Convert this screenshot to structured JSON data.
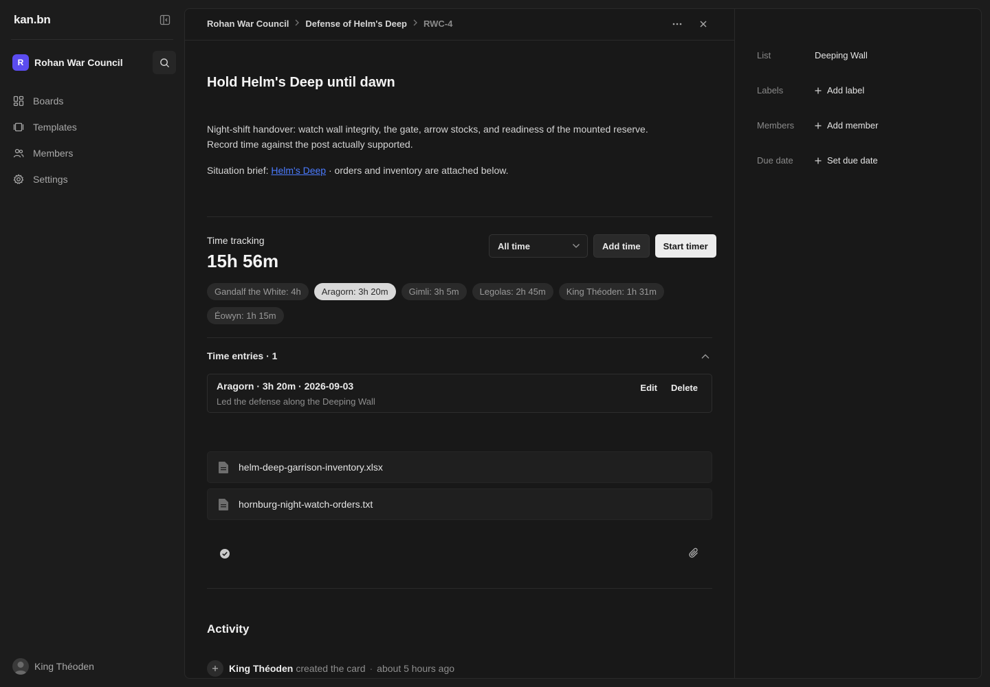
{
  "app": {
    "logo": "kan.bn"
  },
  "sidebar": {
    "workspace": {
      "initial": "R",
      "name": "Rohan War Council",
      "color": "#5b4cf0"
    },
    "items": [
      {
        "label": "Boards",
        "icon": "boards-icon"
      },
      {
        "label": "Templates",
        "icon": "templates-icon"
      },
      {
        "label": "Members",
        "icon": "members-icon"
      },
      {
        "label": "Settings",
        "icon": "settings-icon"
      }
    ],
    "user": {
      "name": "King Théoden"
    }
  },
  "breadcrumb": [
    "Rohan War Council",
    "Defense of Helm's Deep",
    "RWC-4"
  ],
  "card": {
    "title": "Hold Helm's Deep until dawn",
    "description": {
      "p1": "Night-shift handover: watch wall integrity, the gate, arrow stocks, and readiness of the mounted reserve. Record time against the post actually supported.",
      "p2_prefix": "Situation brief: ",
      "p2_link": "Helm's Deep",
      "p2_suffix": " · orders and inventory are attached below."
    }
  },
  "time_tracking": {
    "label": "Time tracking",
    "total": "15h 56m",
    "range_select": "All time",
    "add_time_label": "Add time",
    "start_timer_label": "Start timer",
    "chips": [
      {
        "label": "Gandalf the White: 4h",
        "active": false
      },
      {
        "label": "Aragorn: 3h 20m",
        "active": true
      },
      {
        "label": "Gimli: 3h 5m",
        "active": false
      },
      {
        "label": "Legolas: 2h 45m",
        "active": false
      },
      {
        "label": "King Théoden: 1h 31m",
        "active": false
      },
      {
        "label": "Éowyn: 1h 15m",
        "active": false
      }
    ]
  },
  "time_entries": {
    "heading": "Time entries · 1",
    "items": [
      {
        "title": "Aragorn · 3h 20m · 2026-09-03",
        "note": "Led the defense along the Deeping Wall",
        "edit_label": "Edit",
        "delete_label": "Delete"
      }
    ]
  },
  "attachments": [
    {
      "name": "helm-deep-garrison-inventory.xlsx"
    },
    {
      "name": "hornburg-night-watch-orders.txt"
    }
  ],
  "activity": {
    "title": "Activity",
    "items": [
      {
        "user": "King Théoden",
        "text": "created the card",
        "time": "about 5 hours ago"
      }
    ]
  },
  "properties": {
    "list": {
      "label": "List",
      "value": "Deeping Wall"
    },
    "labels": {
      "label": "Labels",
      "value": "Add label"
    },
    "members": {
      "label": "Members",
      "value": "Add member"
    },
    "due_date": {
      "label": "Due date",
      "value": "Set due date"
    }
  }
}
